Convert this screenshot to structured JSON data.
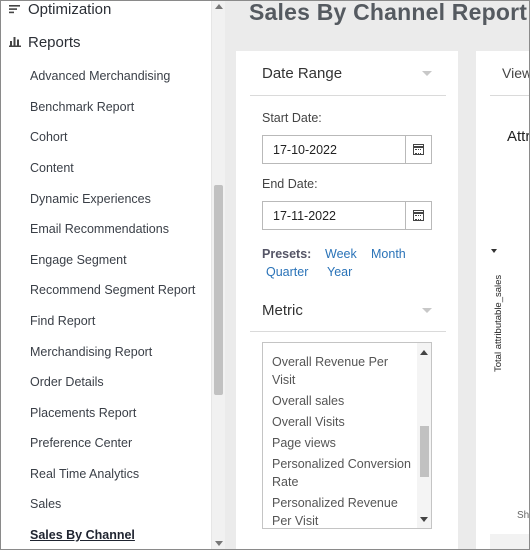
{
  "sidebar": {
    "sections": [
      {
        "label": "Optimization",
        "icon": "sort-lines-icon"
      },
      {
        "label": "Reports",
        "icon": "bar-chart-icon"
      }
    ],
    "items": [
      {
        "label": "Advanced Merchandising"
      },
      {
        "label": "Benchmark Report"
      },
      {
        "label": "Cohort"
      },
      {
        "label": "Content"
      },
      {
        "label": "Dynamic Experiences"
      },
      {
        "label": "Email Recommendations"
      },
      {
        "label": "Engage Segment"
      },
      {
        "label": "Recommend Segment Report"
      },
      {
        "label": "Find Report"
      },
      {
        "label": "Merchandising Report"
      },
      {
        "label": "Order Details"
      },
      {
        "label": "Placements Report"
      },
      {
        "label": "Preference Center"
      },
      {
        "label": "Real Time Analytics"
      },
      {
        "label": "Sales"
      },
      {
        "label": "Sales By Channel",
        "active": true
      }
    ]
  },
  "page": {
    "title": "Sales By Channel Report"
  },
  "filters": {
    "date_range": {
      "title": "Date Range",
      "start_label": "Start Date:",
      "start_value": "17-10-2022",
      "end_label": "End Date:",
      "end_value": "17-11-2022"
    },
    "presets": {
      "label": "Presets:",
      "options": [
        "Week",
        "Month",
        "Quarter",
        "Year"
      ]
    },
    "metric": {
      "title": "Metric",
      "options": [
        "Overall Revenue Per Visit",
        "Overall sales",
        "Overall Visits",
        "Page views",
        "Personalized Conversion Rate",
        "Personalized Revenue Per Visit"
      ]
    }
  },
  "chart_panel": {
    "view_label": "View",
    "title": "Attri",
    "y_axis_label": "Total attributable_sales",
    "footer_label": "Sh"
  },
  "colors": {
    "link": "#2a73b8",
    "main_bg": "#ebebeb",
    "card_bg": "#ffffff"
  }
}
